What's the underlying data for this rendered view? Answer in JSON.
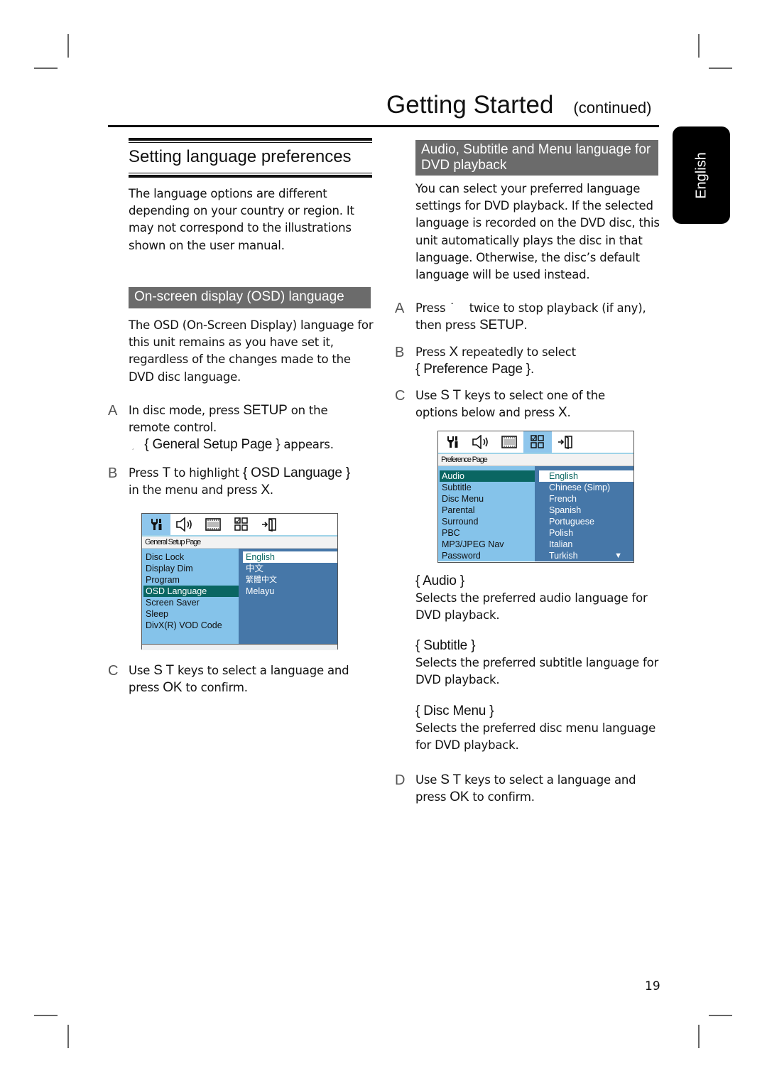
{
  "header": {
    "title": "Getting Started",
    "continued": "(continued)"
  },
  "language_tab": "English",
  "left": {
    "section_title": "Setting language preferences",
    "intro": "The language options are different depending on your country or region. It may not correspond to the illustrations shown on the user manual.",
    "osd_heading": "On-screen display (OSD) language",
    "osd_paragraph": "The OSD (On-Screen Display) language for this unit remains as you have set it, regardless of the changes made to the DVD disc language.",
    "steps": [
      {
        "letter": "A",
        "line1_pre": "In disc mode, press ",
        "line1_key": "SETUP",
        "line1_post": " on the",
        "line2": "remote control.",
        "result_mark": "¸",
        "result_key": "{ General Setup Page }",
        "result_post": " appears."
      },
      {
        "letter": "B",
        "pre": "Press ",
        "key1": "T",
        "mid": " to highlight ",
        "key2": "{ OSD Language }",
        "line2_pre": "in the menu and press ",
        "line2_key": "X",
        "line2_post": "."
      },
      {
        "letter": "C",
        "pre": "Use ",
        "keys": "S T",
        "post": " keys to select a language and",
        "line2_pre": "press ",
        "line2_key": "OK",
        "line2_post": " to confirm."
      }
    ],
    "osd_screen": {
      "page_label": "General Setup Page",
      "icons": [
        "general-setup-icon",
        "audio-setup-icon",
        "video-setup-icon",
        "preference-icon",
        "exit-icon"
      ],
      "active_icon": 0,
      "menu_items": [
        "Disc Lock",
        "Display Dim",
        "Program",
        "OSD Language",
        "Screen Saver",
        "Sleep",
        "DivX(R) VOD Code"
      ],
      "selected_item": "OSD Language",
      "options": [
        "English",
        "中文",
        "繁體中文",
        "Melayu"
      ],
      "selected_option": "English"
    }
  },
  "right": {
    "heading": "Audio, Subtitle and Menu language for DVD playback",
    "intro": "You can select your preferred language settings for DVD playback. If the selected language is recorded on the DVD disc, this unit automatically plays the disc in that language. Otherwise, the disc’s default language will be used instead.",
    "steps": [
      {
        "letter": "A",
        "pre": "Press ",
        "key": "˙",
        "post": "    twice to stop playback (if any),",
        "line2_pre": "then press ",
        "line2_key": "SETUP",
        "line2_post": "."
      },
      {
        "letter": "B",
        "pre": "Press ",
        "key": "X",
        "post": " repeatedly to select",
        "line2_key": "{ Preference Page }",
        "line2_post": "."
      },
      {
        "letter": "C",
        "pre": "Use ",
        "keys": "S T",
        "post": " keys to select one of the",
        "line2_pre": "options below and press ",
        "line2_key": "X",
        "line2_post": "."
      },
      {
        "letter": "D",
        "pre": "Use ",
        "keys": "S T",
        "post": " keys to select a language and",
        "line2_pre": "press ",
        "line2_key": "OK",
        "line2_post": " to confirm."
      }
    ],
    "osd_screen": {
      "page_label": "Preference Page",
      "icons": [
        "general-setup-icon",
        "audio-setup-icon",
        "video-setup-icon",
        "preference-icon",
        "exit-icon"
      ],
      "active_icon": 3,
      "menu_items": [
        "Audio",
        "Subtitle",
        "Disc Menu",
        "Parental",
        "Surround",
        "PBC",
        "MP3/JPEG Nav",
        "Password"
      ],
      "selected_item": "Audio",
      "options": [
        "English",
        "Chinese (Simp)",
        "French",
        "Spanish",
        "Portuguese",
        "Polish",
        "Italian",
        "Turkish"
      ],
      "selected_option": "English",
      "scroll_indicator": "▼"
    },
    "options": [
      {
        "title": "{ Audio }",
        "desc": "Selects the preferred audio language for DVD playback."
      },
      {
        "title": "{ Subtitle }",
        "desc": "Selects the preferred subtitle language for DVD playback."
      },
      {
        "title": "{ Disc Menu }",
        "desc": "Selects the preferred disc menu language for DVD playback."
      }
    ]
  },
  "page_number": "19"
}
